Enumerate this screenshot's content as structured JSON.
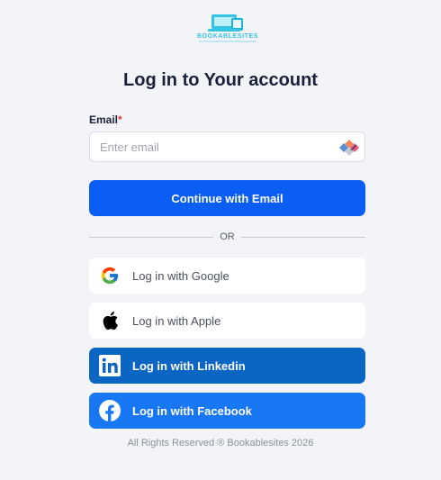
{
  "brand": {
    "name": "BOOKABLESITES",
    "color": "#36c4e6"
  },
  "page": {
    "title": "Log in to Your account"
  },
  "form": {
    "email_label": "Email",
    "required_mark": "*",
    "email_placeholder": "Enter email",
    "email_value": "",
    "continue_label": "Continue with Email",
    "divider_text": "OR"
  },
  "social": [
    {
      "label": "Log in with Google",
      "icon": "google-icon"
    },
    {
      "label": "Log in with Apple",
      "icon": "apple-icon"
    },
    {
      "label": "Log in with Linkedin",
      "icon": "linkedin-icon"
    },
    {
      "label": "Log in with Facebook",
      "icon": "facebook-icon"
    }
  ],
  "footer": {
    "text": "All Rights Reserved ® Bookablesites 2026"
  },
  "colors": {
    "primary": "#0a5df5",
    "linkedin": "#0a66c2",
    "facebook": "#1877f2",
    "title": "#1a1f3d"
  }
}
